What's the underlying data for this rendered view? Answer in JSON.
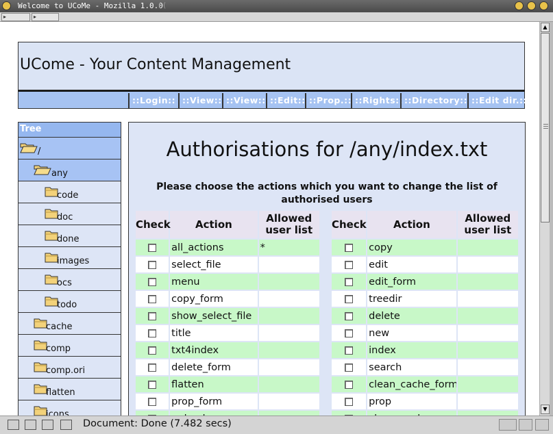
{
  "window": {
    "title": "Welcome to UCoMe - Mozilla 1.0.0"
  },
  "header": {
    "site_title": "UCome - Your Content Management"
  },
  "menu": {
    "items": [
      "::Login::",
      "::View::",
      "::View::",
      "::Edit::",
      "::Prop.::",
      "::Rights::",
      "::Directory::",
      "::Edit dir.::"
    ]
  },
  "tree": {
    "heading": "Tree",
    "nodes": [
      {
        "label": "/",
        "open": true
      },
      {
        "label": "any",
        "open": true
      },
      {
        "label": "code",
        "open": false
      },
      {
        "label": "doc",
        "open": false
      },
      {
        "label": "done",
        "open": false
      },
      {
        "label": "images",
        "open": false
      },
      {
        "label": "ocs",
        "open": false
      },
      {
        "label": "todo",
        "open": false
      },
      {
        "label": "cache",
        "open": false
      },
      {
        "label": "comp",
        "open": false
      },
      {
        "label": "comp.ori",
        "open": false
      },
      {
        "label": "flatten",
        "open": false
      },
      {
        "label": "icons",
        "open": false
      }
    ]
  },
  "main": {
    "title": "Authorisations for /any/index.txt",
    "instructions": "Please choose the actions which you want to change the list of authorised users",
    "columns": {
      "check": "Check",
      "action": "Action",
      "allowed": "Allowed user list"
    },
    "rows": [
      {
        "left_action": "all_actions",
        "left_allowed": "*",
        "right_action": "copy",
        "right_allowed": ""
      },
      {
        "left_action": "select_file",
        "left_allowed": "",
        "right_action": "edit",
        "right_allowed": ""
      },
      {
        "left_action": "menu",
        "left_allowed": "",
        "right_action": "edit_form",
        "right_allowed": ""
      },
      {
        "left_action": "copy_form",
        "left_allowed": "",
        "right_action": "treedir",
        "right_allowed": ""
      },
      {
        "left_action": "show_select_file",
        "left_allowed": "",
        "right_action": "delete",
        "right_allowed": ""
      },
      {
        "left_action": "title",
        "left_allowed": "",
        "right_action": "new",
        "right_allowed": ""
      },
      {
        "left_action": "txt4index",
        "left_allowed": "",
        "right_action": "index",
        "right_allowed": ""
      },
      {
        "left_action": "delete_form",
        "left_allowed": "",
        "right_action": "search",
        "right_allowed": ""
      },
      {
        "left_action": "flatten",
        "left_allowed": "",
        "right_action": "clean_cache_form",
        "right_allowed": ""
      },
      {
        "left_action": "prop_form",
        "left_allowed": "",
        "right_action": "prop",
        "right_allowed": ""
      },
      {
        "left_action": "upload",
        "left_allowed": "",
        "right_action": "clean_cache",
        "right_allowed": ""
      }
    ]
  },
  "status": {
    "text": "Document: Done (7.482 secs)"
  },
  "colors": {
    "header_bg": "#dbe4f5",
    "menubar_bg": "#a6c3f2",
    "tree_open_bg": "#a7c3f4",
    "row_green": "#c8f8c8",
    "table_header_bg": "#e8e3f0"
  }
}
